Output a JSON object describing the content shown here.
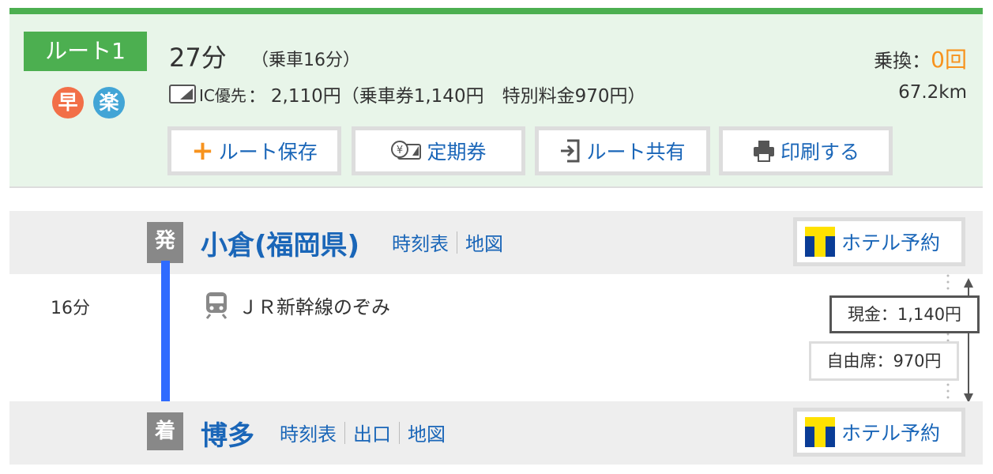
{
  "summary": {
    "route_label": "ルート1",
    "badges": [
      "早",
      "楽"
    ],
    "total_time": "27分",
    "ride_time": "（乗車16分）",
    "fare": {
      "ic_label": "IC優先",
      "separator": "：",
      "total": "2,110円",
      "breakdown": "（乗車券1,140円　特別料金970円）"
    },
    "transfer_label": "乗換：",
    "transfer_count": "0回",
    "distance": "67.2km"
  },
  "actions": {
    "save": "ルート保存",
    "pass": "定期券",
    "share": "ルート共有",
    "print": "印刷する"
  },
  "departure": {
    "mark": "発",
    "name": "小倉(福岡県)",
    "links": [
      "時刻表",
      "地図"
    ],
    "hotel": "ホテル予約"
  },
  "segment": {
    "time": "16分",
    "train": "ＪＲ新幹線のぞみ",
    "fare_cash": "現金：1,140円",
    "fare_seat": "自由席：970円"
  },
  "arrival": {
    "mark": "着",
    "name": "博多",
    "links": [
      "時刻表",
      "出口",
      "地図"
    ],
    "hotel": "ホテル予約"
  },
  "colors": {
    "accent_green": "#4caf50",
    "link_blue": "#1a66b8",
    "orange": "#f7931e",
    "route_line": "#2f6bff"
  },
  "icons": [
    "plus-icon",
    "commuter-pass-icon",
    "share-icon",
    "printer-icon",
    "train-icon",
    "t-logo-icon",
    "ic-card-icon"
  ]
}
